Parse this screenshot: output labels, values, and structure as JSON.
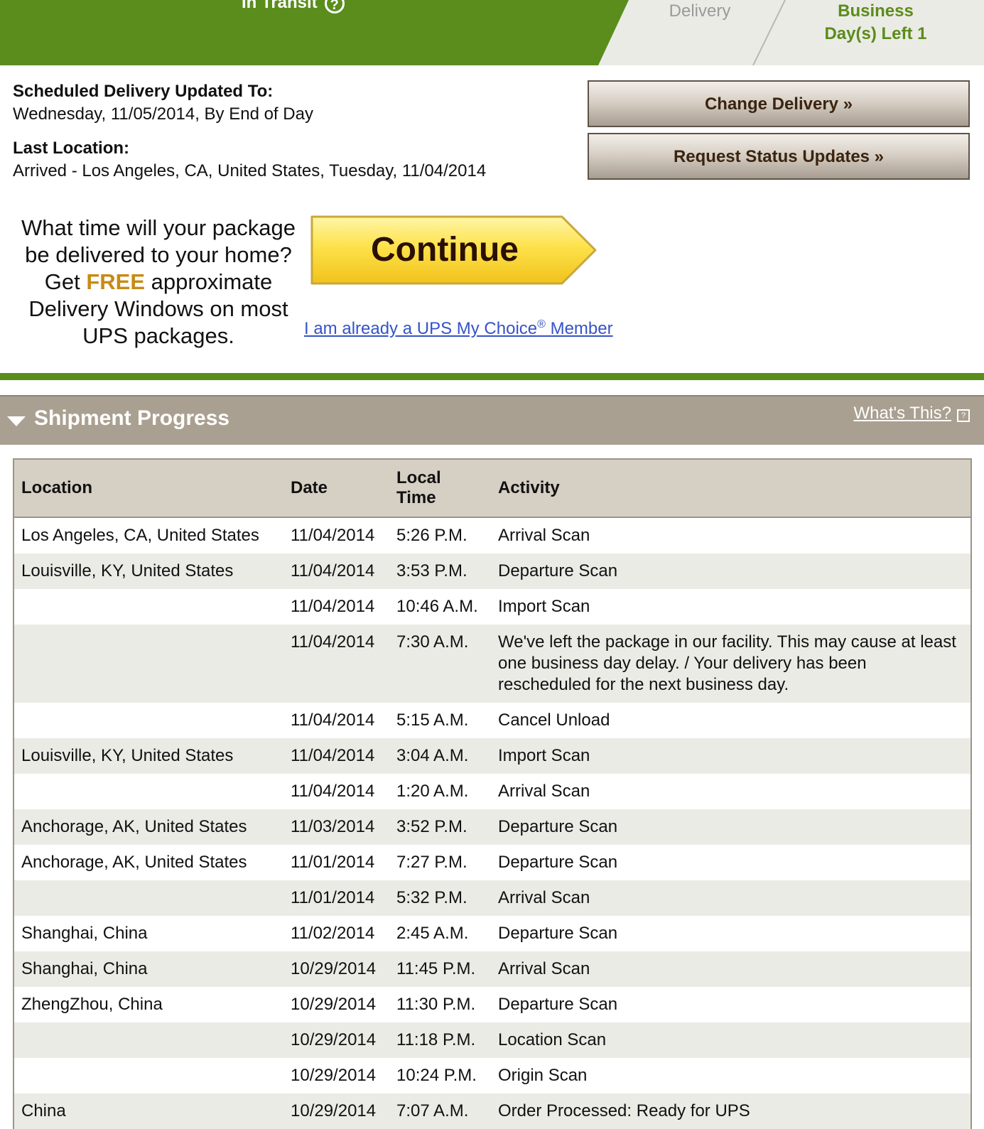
{
  "banner": {
    "status": "In Transit",
    "help_glyph": "?",
    "step_delivery": "Delivery",
    "step_days_line1": "Business",
    "step_days_line2": "Day(s) Left 1",
    "colors": {
      "accent_green": "#5a8d1c",
      "step_bg": "#ebebe6"
    }
  },
  "delivery": {
    "scheduled_label": "Scheduled Delivery Updated To:",
    "scheduled_value": "Wednesday, 11/05/2014, By End of Day",
    "last_location_label": "Last Location:",
    "last_location_value": "Arrived - Los Angeles, CA, United States, Tuesday, 11/04/2014"
  },
  "actions": {
    "change_delivery": "Change Delivery »",
    "request_updates": "Request Status Updates »"
  },
  "promo": {
    "line1": "What time will your package",
    "line2": "be delivered to your home?",
    "line3_pre": "Get ",
    "line3_free": "FREE",
    "line3_post": " approximate",
    "line4": "Delivery Windows on most",
    "line5": "UPS packages.",
    "continue": "Continue",
    "member_pre": "I am already a UPS My Choice",
    "member_reg": "®",
    "member_post": " Member"
  },
  "progress": {
    "title": "Shipment Progress",
    "whats_this": "What's This?",
    "columns": {
      "location": "Location",
      "date": "Date",
      "time_line1": "Local",
      "time_line2": "Time",
      "activity": "Activity"
    },
    "rows": [
      {
        "location": "Los Angeles, CA, United States",
        "date": "11/04/2014",
        "time": "5:26 P.M.",
        "activity": "Arrival Scan"
      },
      {
        "location": "Louisville, KY, United States",
        "date": "11/04/2014",
        "time": "3:53 P.M.",
        "activity": "Departure Scan"
      },
      {
        "location": "",
        "date": "11/04/2014",
        "time": "10:46 A.M.",
        "activity": "Import Scan"
      },
      {
        "location": "",
        "date": "11/04/2014",
        "time": "7:30 A.M.",
        "activity": "We've left the package in our facility. This may cause at least one business day delay. / Your delivery has been rescheduled for the next business day."
      },
      {
        "location": "",
        "date": "11/04/2014",
        "time": "5:15 A.M.",
        "activity": "Cancel Unload"
      },
      {
        "location": "Louisville, KY, United States",
        "date": "11/04/2014",
        "time": "3:04 A.M.",
        "activity": "Import Scan"
      },
      {
        "location": "",
        "date": "11/04/2014",
        "time": "1:20 A.M.",
        "activity": "Arrival Scan"
      },
      {
        "location": "Anchorage, AK, United States",
        "date": "11/03/2014",
        "time": "3:52 P.M.",
        "activity": "Departure Scan"
      },
      {
        "location": "Anchorage, AK, United States",
        "date": "11/01/2014",
        "time": "7:27 P.M.",
        "activity": "Departure Scan"
      },
      {
        "location": "",
        "date": "11/01/2014",
        "time": "5:32 P.M.",
        "activity": "Arrival Scan"
      },
      {
        "location": "Shanghai, China",
        "date": "11/02/2014",
        "time": "2:45 A.M.",
        "activity": "Departure Scan"
      },
      {
        "location": "Shanghai, China",
        "date": "10/29/2014",
        "time": "11:45 P.M.",
        "activity": "Arrival Scan"
      },
      {
        "location": "ZhengZhou, China",
        "date": "10/29/2014",
        "time": "11:30 P.M.",
        "activity": "Departure Scan"
      },
      {
        "location": "",
        "date": "10/29/2014",
        "time": "11:18 P.M.",
        "activity": "Location Scan"
      },
      {
        "location": "",
        "date": "10/29/2014",
        "time": "10:24 P.M.",
        "activity": "Origin Scan"
      },
      {
        "location": "China",
        "date": "10/29/2014",
        "time": "7:07 A.M.",
        "activity": "Order Processed: Ready for UPS"
      }
    ]
  }
}
